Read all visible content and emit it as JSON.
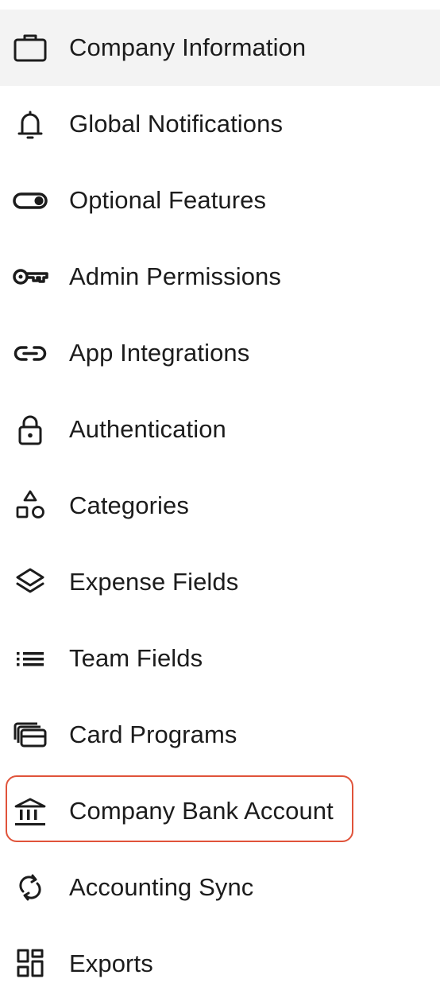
{
  "menu": {
    "items": [
      {
        "label": "Company Information",
        "icon": "briefcase-icon",
        "active": true
      },
      {
        "label": "Global Notifications",
        "icon": "bell-icon"
      },
      {
        "label": "Optional Features",
        "icon": "toggle-icon"
      },
      {
        "label": "Admin Permissions",
        "icon": "key-icon"
      },
      {
        "label": "App Integrations",
        "icon": "link-icon"
      },
      {
        "label": "Authentication",
        "icon": "lock-icon"
      },
      {
        "label": "Categories",
        "icon": "shapes-icon"
      },
      {
        "label": "Expense Fields",
        "icon": "layers-icon"
      },
      {
        "label": "Team Fields",
        "icon": "list-icon"
      },
      {
        "label": "Card Programs",
        "icon": "cards-icon"
      },
      {
        "label": "Company Bank Account",
        "icon": "bank-icon",
        "highlighted": true
      },
      {
        "label": "Accounting Sync",
        "icon": "sync-icon"
      },
      {
        "label": "Exports",
        "icon": "grid-icon"
      }
    ]
  },
  "colors": {
    "active_background": "#f3f3f3",
    "highlight_border": "#e0533a",
    "text": "#1c1c1c"
  }
}
